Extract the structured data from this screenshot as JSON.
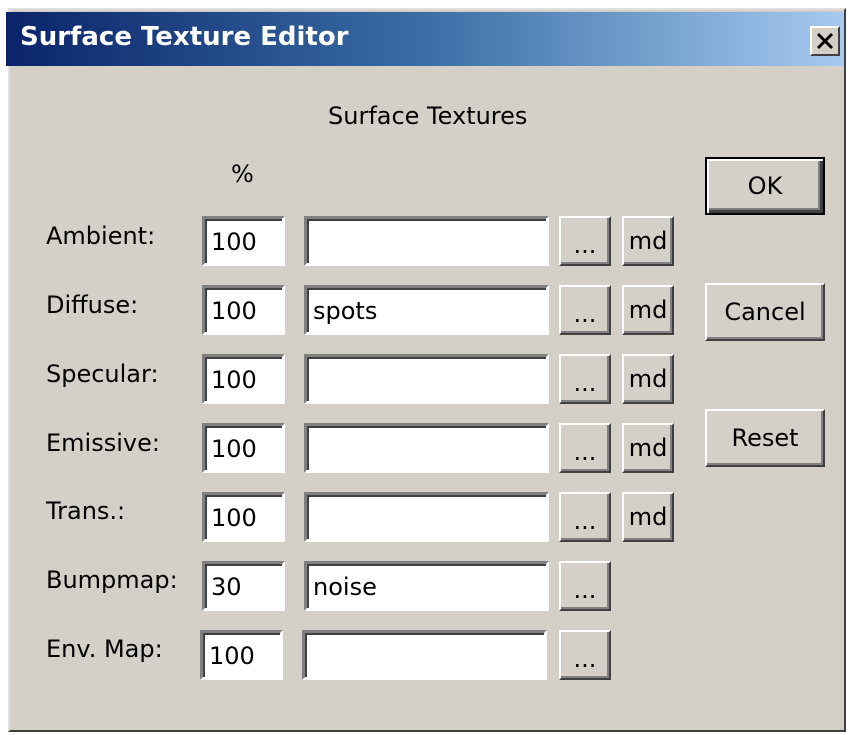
{
  "window": {
    "title": "Surface Texture Editor"
  },
  "heading": "Surface Textures",
  "percent_header": "%",
  "rows": [
    {
      "label": "Ambient:",
      "percent": "100",
      "texture": "",
      "browse": "...",
      "md": "md"
    },
    {
      "label": "Diffuse:",
      "percent": "100",
      "texture": "spots",
      "browse": "...",
      "md": "md"
    },
    {
      "label": "Specular:",
      "percent": "100",
      "texture": "",
      "browse": "...",
      "md": "md"
    },
    {
      "label": "Emissive:",
      "percent": "100",
      "texture": "",
      "browse": "...",
      "md": "md"
    },
    {
      "label": "Trans.:",
      "percent": "100",
      "texture": "",
      "browse": "...",
      "md": "md"
    },
    {
      "label": "Bumpmap:",
      "percent": "30",
      "texture": "noise",
      "browse": "..."
    },
    {
      "label": "Env. Map:",
      "percent": "100",
      "texture": "",
      "browse": "..."
    }
  ],
  "buttons": {
    "ok": "OK",
    "cancel": "Cancel",
    "reset": "Reset"
  },
  "icons": {
    "close": "close-icon"
  }
}
